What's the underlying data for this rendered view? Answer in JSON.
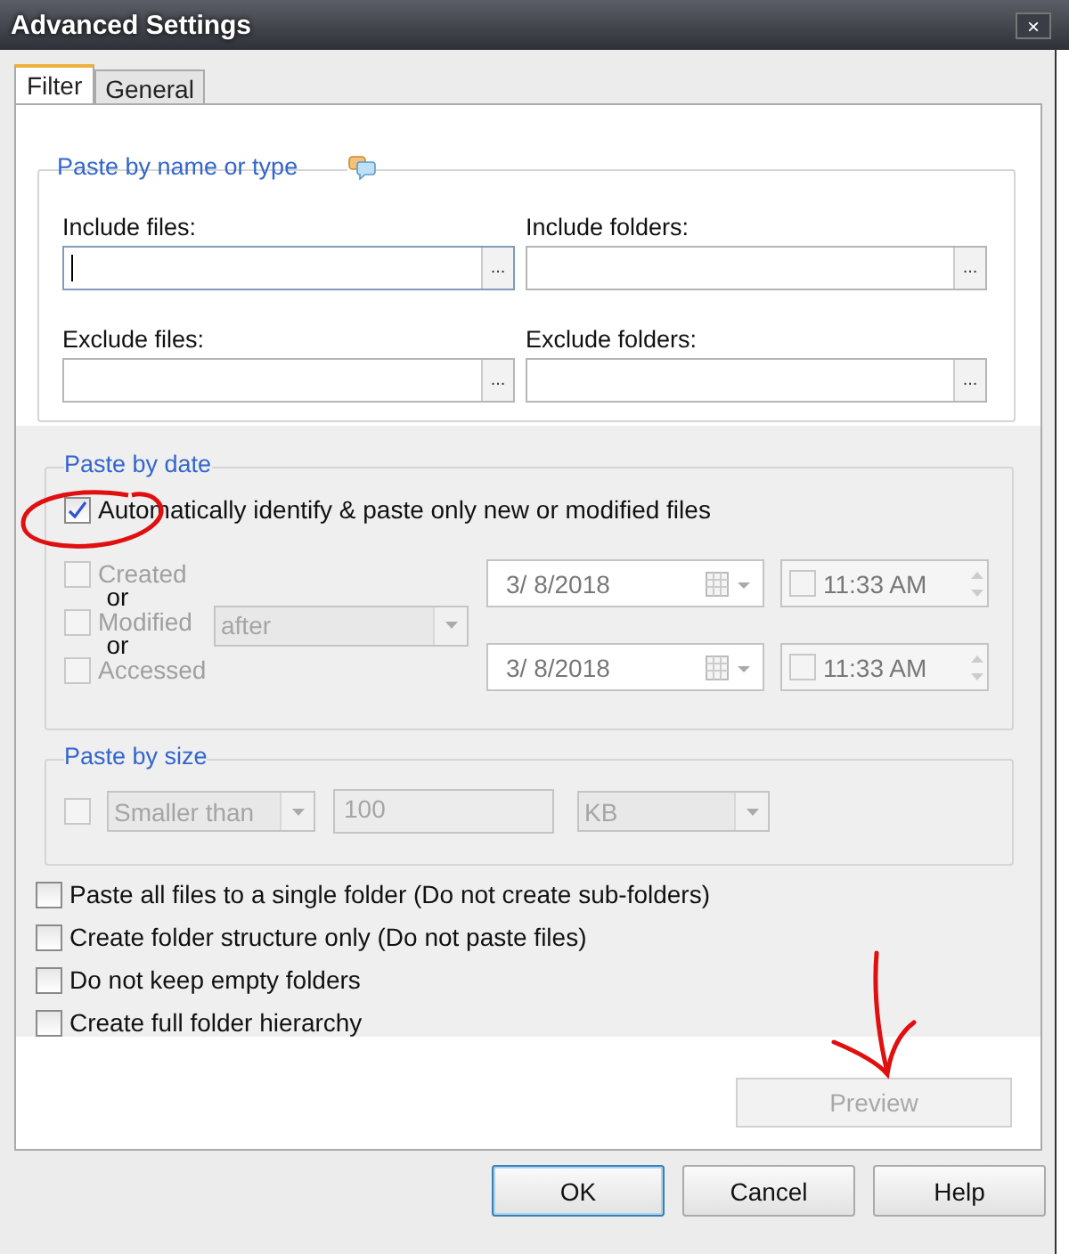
{
  "window": {
    "title": "Advanced Settings",
    "close": "×"
  },
  "tabs": [
    {
      "label": "Filter",
      "selected": true
    },
    {
      "label": "General",
      "selected": false
    }
  ],
  "name_group": {
    "title": "Paste by name or type",
    "fields": [
      {
        "label": "Include files:",
        "focused": true,
        "browse": "..."
      },
      {
        "label": "Include folders:",
        "focused": false,
        "browse": "..."
      },
      {
        "label": "Exclude files:",
        "focused": false,
        "browse": "..."
      },
      {
        "label": "Exclude folders:",
        "focused": false,
        "browse": "..."
      }
    ]
  },
  "date_group": {
    "title": "Paste by date",
    "auto": {
      "label": "Automatically identify & paste only new or modified files",
      "checked": true
    },
    "disabled": true,
    "date_options": [
      {
        "label": "Created",
        "checked": false
      },
      {
        "label": "Modified",
        "checked": false
      },
      {
        "label": "Accessed",
        "checked": false
      }
    ],
    "connectors": [
      "or",
      "or"
    ],
    "comparison": "after",
    "ranges": [
      {
        "date": "3/  8/2018",
        "time": "11:33 AM",
        "time_checked": false
      },
      {
        "date": "3/  8/2018",
        "time": "11:33 AM",
        "time_checked": false
      }
    ]
  },
  "size_group": {
    "title": "Paste by size",
    "checked": false,
    "disabled": true,
    "comparison": "Smaller than",
    "amount": "100",
    "unit": "KB"
  },
  "options": [
    {
      "label": "Paste all files to a single folder (Do not create sub-folders)",
      "checked": false
    },
    {
      "label": "Create folder structure only (Do not paste files)",
      "checked": false
    },
    {
      "label": "Do not keep empty folders",
      "checked": false
    },
    {
      "label": "Create full folder hierarchy",
      "checked": false
    }
  ],
  "preview_button": {
    "label": "Preview",
    "disabled": true
  },
  "buttons": [
    {
      "label": "OK",
      "default": true
    },
    {
      "label": "Cancel",
      "default": false
    },
    {
      "label": "Help",
      "default": false
    }
  ]
}
